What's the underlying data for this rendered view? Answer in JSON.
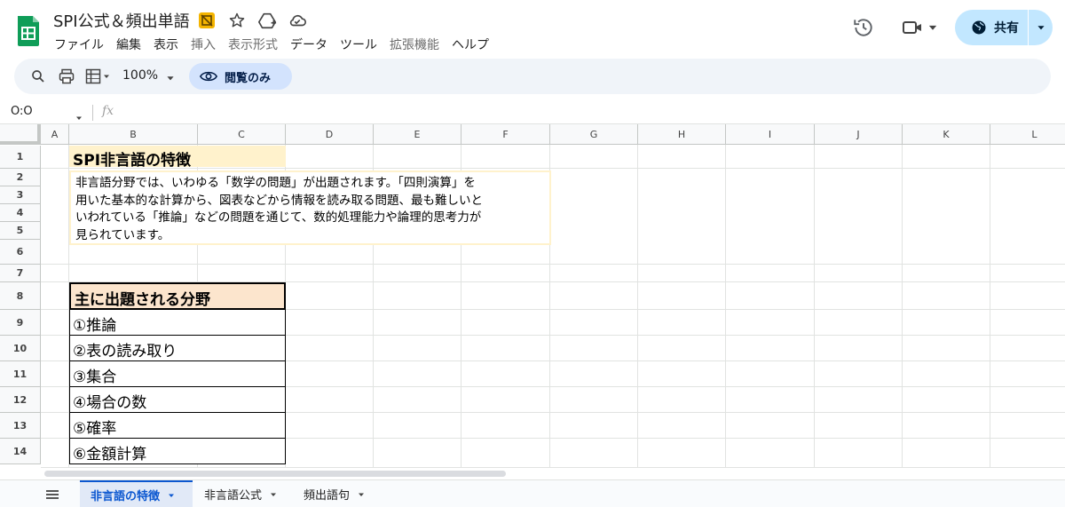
{
  "app": {
    "doc_title": "SPI公式＆頻出単語",
    "brand_color": "#0f9d58",
    "menu": [
      "ファイル",
      "編集",
      "表示",
      "挿入",
      "表示形式",
      "データ",
      "ツール",
      "拡張機能",
      "ヘルプ"
    ],
    "menu_dimmed": [
      false,
      false,
      false,
      true,
      true,
      false,
      false,
      true,
      false
    ],
    "share_label": "共有"
  },
  "toolbar": {
    "zoom": "100%",
    "view_only_label": "閲覧のみ"
  },
  "formula_bar": {
    "name_box": "O:O",
    "fx_label": "fx"
  },
  "grid": {
    "columns": [
      "A",
      "B",
      "C",
      "D",
      "E",
      "F",
      "G",
      "H",
      "I",
      "J",
      "K",
      "L"
    ],
    "rows": [
      "1",
      "2",
      "3",
      "4",
      "5",
      "6",
      "7",
      "8",
      "9",
      "10",
      "11",
      "12",
      "13",
      "14"
    ],
    "cells": {
      "b1_title": "SPI非言語の特徴",
      "description_lines": [
        "非言語分野では、いわゆる「数学の問題」が出題されます。「四則演算」を",
        "用いた基本的な計算から、図表などから情報を読み取る問題、最も難しいと",
        "いわれている「推論」などの問題を通じて、数的処理能力や論理的思考力が",
        "見られています。"
      ],
      "table_header": "主に出題される分野",
      "table_items": [
        "①推論",
        "②表の読み取り",
        "③集合",
        "④場合の数",
        "⑤確率",
        "⑥金額計算"
      ]
    }
  },
  "sheets": {
    "tabs": [
      "非言語の特徴",
      "非言語公式",
      "頻出語句"
    ],
    "active_index": 0
  }
}
